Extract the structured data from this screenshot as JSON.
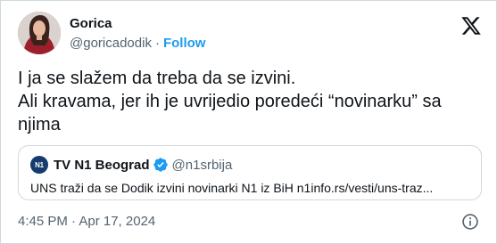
{
  "author": {
    "name": "Gorica",
    "handle": "@goricadodik",
    "separator": "·",
    "follow_label": "Follow"
  },
  "tweet": {
    "text": "I ja se slažem da treba da se izvini.\nAli kravama, jer ih je uvrijedio poredeći “novinarku” sa njima"
  },
  "quoted": {
    "avatar_text": "N1",
    "name": "TV N1 Beograd",
    "handle": "@n1srbija",
    "text": "UNS traži da se Dodik izvini novinarki N1 iz BiH n1info.rs/vesti/uns-traz..."
  },
  "footer": {
    "timestamp": "4:45 PM · Apr 17, 2024"
  },
  "icons": {
    "x_logo": "x-logo-icon",
    "verified": "verified-badge-icon",
    "info": "info-icon"
  },
  "colors": {
    "link": "#1d9bf0",
    "secondary_text": "#536471",
    "border": "#cfd9de",
    "verified_badge": "#1d9bf0"
  }
}
